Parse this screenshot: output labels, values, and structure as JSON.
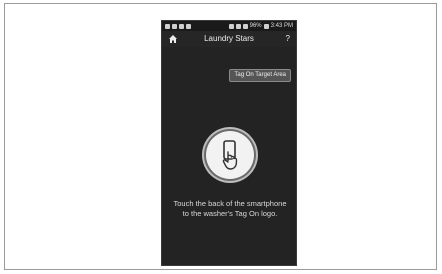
{
  "status_bar": {
    "time": "3:43 PM",
    "battery": "96%"
  },
  "app_bar": {
    "title": "Laundry Stars",
    "home_icon": "home-icon",
    "help_label": "?"
  },
  "tag_button": {
    "label": "Tag On Target Area"
  },
  "instruction": {
    "text": "Touch the back of the smartphone to the washer's Tag On logo."
  },
  "colors": {
    "screen_background": "#232323",
    "circle_fill": "#f2f2f2"
  }
}
